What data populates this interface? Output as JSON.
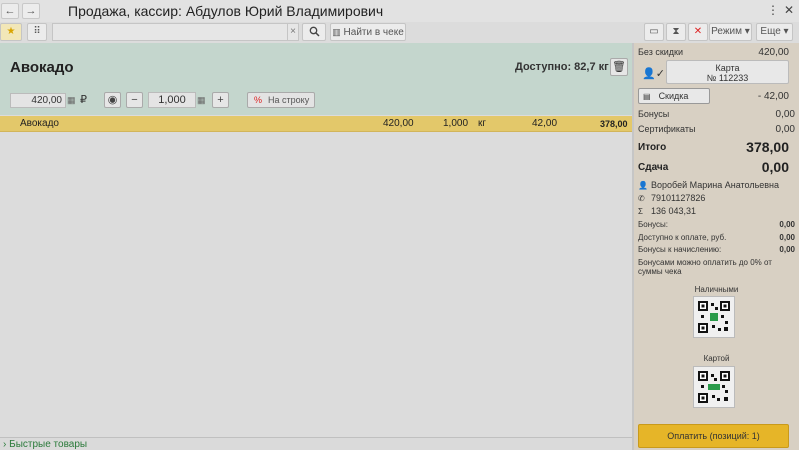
{
  "window": {
    "title": "Продажа, кассир: Абдулов Юрий Владимирович"
  },
  "toolbar": {
    "find_in_receipt": "Найти в чеке",
    "mode_label": "Режим",
    "more_label": "Еще",
    "search_value": ""
  },
  "product": {
    "name": "Авокадо",
    "available": "Доступно: 82,7 кг",
    "price": "420,00",
    "currency": "₽",
    "quantity": "1,000",
    "to_line_label": "На строку",
    "to_line_icon": "%"
  },
  "items": [
    {
      "name": "Авокадо",
      "price": "420,00",
      "qty": "1,000",
      "unit": "кг",
      "discount": "42,00",
      "sum": "378,00"
    }
  ],
  "quick_goods_label": "Быстрые товары",
  "summary": {
    "no_discount_label": "Без скидки",
    "no_discount_value": "420,00",
    "card_line1": "Карта",
    "card_line2": "№ 112233",
    "discount_label": "Скидка",
    "discount_value": "- 42,00",
    "bonuses_label": "Бонусы",
    "bonuses_value": "0,00",
    "certificates_label": "Сертификаты",
    "certificates_value": "0,00",
    "total_label": "Итого",
    "total_value": "378,00",
    "change_label": "Сдача",
    "change_value": "0,00"
  },
  "client": {
    "name": "Воробей Марина Анатольевна",
    "phone": "79101127826",
    "sum": "136 043,31",
    "bonuses_label": "Бонусы:",
    "bonuses_value": "0,00",
    "available_label": "Доступно к оплате, руб.",
    "available_value": "0,00",
    "accrual_label": "Бонусы к начислению:",
    "accrual_value": "0,00",
    "bonus_note_1": "Бонусами можно оплатить до 0% от",
    "bonus_note_2": "суммы чека"
  },
  "payment": {
    "cash_label": "Наличными",
    "card_label": "Картой",
    "pay_button": "Оплатить (позиций: 1)"
  },
  "colors": {
    "accent_yellow": "#e6b528",
    "product_panel": "#c4d6cd",
    "item_row": "#e3c86a",
    "right_panel": "#d8d0c3"
  }
}
